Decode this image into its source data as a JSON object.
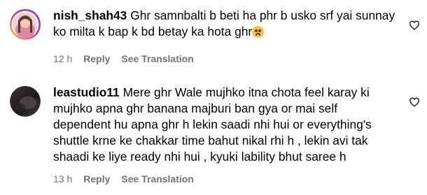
{
  "comments": [
    {
      "username": "nish_shah43",
      "text": "Ghr samnbalti b beti ha phr b usko srf yai sunnay\nko milta k bap k bd betay ka hota ghr",
      "emoji": "sad-face-emoji",
      "time": "12 h",
      "reply_label": "Reply",
      "translation_label": "See Translation",
      "like_icon": "heart-outline-icon"
    },
    {
      "username": "leastudio11",
      "text": "Mere ghr Wale mujhko itna chota feel karay ki\nmujhko apna ghr banana majburi ban gya or mai self\ndependent hu apna ghr h lekin saadi nhi hui or everything's\nshuttle krne ke chakkar time bahut nikal rhi h , lekin avi tak\nshaadi ke liye ready nhi hui , kyuki lability bhut saree h",
      "time": "13 h",
      "reply_label": "Reply",
      "translation_label": "See Translation",
      "like_icon": "heart-outline-icon"
    }
  ],
  "colors": {
    "text": "#000000",
    "meta": "#737373",
    "background": "#ffffff"
  }
}
